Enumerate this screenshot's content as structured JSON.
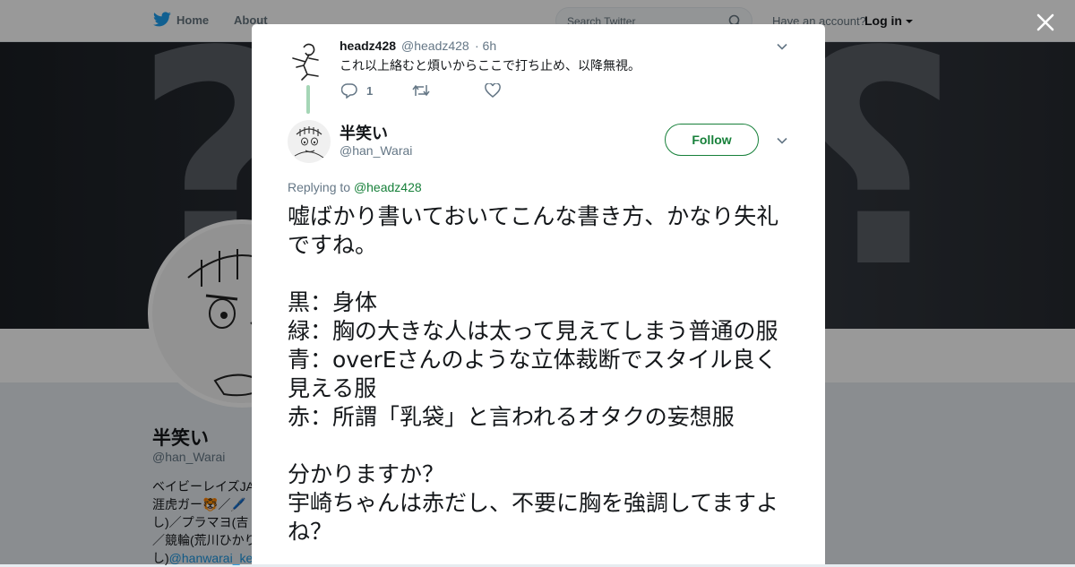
{
  "topbar": {
    "home_label": "Home",
    "about_label": "About",
    "search_placeholder": "Search Twitter",
    "have_account": "Have an account?",
    "login_label": "Log in"
  },
  "profile": {
    "name": "半笑い",
    "handle": "@han_Warai",
    "bio_lines": [
      "ベイビーレイズJA",
      "涯虎ガー🐯／🖊️",
      "し)／プラマヨ(吉",
      "／競輪(荒川ひかり",
      "し)"
    ],
    "bio_link": "@hanwarai_ke"
  },
  "previous_tweet": {
    "name": "headz428",
    "handle": "@headz428",
    "time": "· 6h",
    "text": "これ以上絡むと煩いからここで打ち止め、以降無視。",
    "reply_count": "1",
    "retweet_count": "",
    "like_count": ""
  },
  "tweet": {
    "name": "半笑い",
    "handle": "@han_Warai",
    "follow_label": "Follow",
    "replying_to_label": "Replying to",
    "replying_to_handle": "@headz428",
    "lines": [
      "嘘ばかり書いておいてこんな書き方、かなり失礼ですね。",
      "",
      "黒：身体",
      "緑：胸の大きな人は太って見えてしまう普通の服",
      "青：overEさんのような立体裁断でスタイル良く見える服",
      "赤：所謂「乳袋」と言われるオタクの妄想服",
      "",
      "分かりますか？",
      "宇崎ちゃんは赤だし、不要に胸を強調してますよね？"
    ]
  },
  "colors": {
    "accent_green": "#17803a",
    "thread_line": "#a5d6b6",
    "twitter_blue": "#1da1f2",
    "overlay": "rgba(0,0,0,0.4)"
  },
  "icons": [
    "twitter-bird-icon",
    "search-icon",
    "caret-down-icon",
    "close-icon",
    "reply-icon",
    "retweet-icon",
    "like-icon",
    "chevron-down-icon"
  ]
}
